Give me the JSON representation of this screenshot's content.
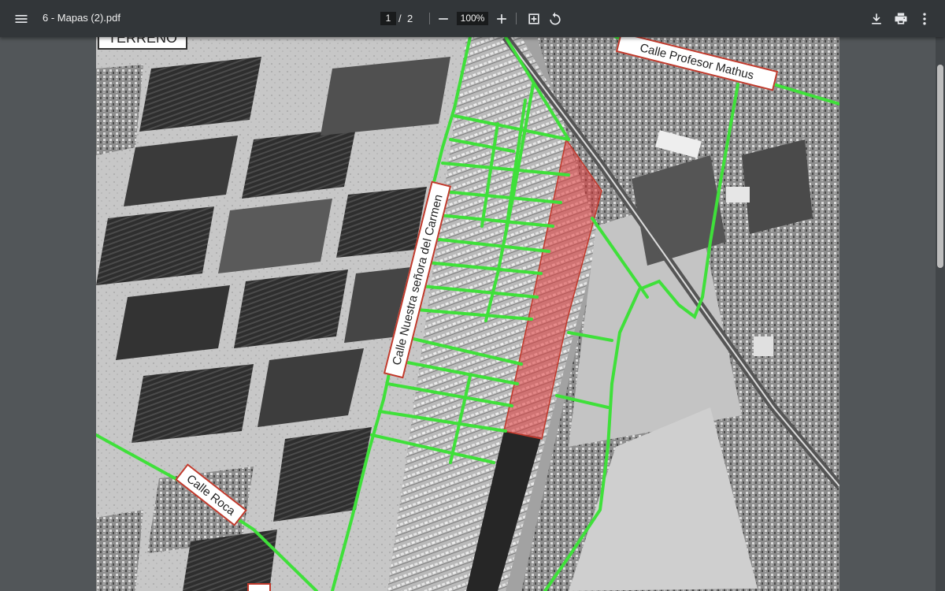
{
  "toolbar": {
    "menu_icon": "menu-icon",
    "title": "6 - Mapas (2).pdf",
    "current_page": "1",
    "page_separator": "/",
    "total_pages": "2",
    "zoom_out_icon": "minus-icon",
    "zoom_level": "100%",
    "zoom_in_icon": "plus-icon",
    "fit_icon": "fit-page-icon",
    "rotate_icon": "rotate-icon",
    "download_icon": "download-icon",
    "print_icon": "print-icon",
    "more_icon": "more-vert-icon"
  },
  "map": {
    "terreno_label": "TERRENO",
    "street_labels": {
      "profesor_mathus": "Calle Profesor Mathus",
      "nuestra_senora": "Calle Nuestra señora del Carmen",
      "roca": "Calle Roca"
    },
    "road_color": "#3fe03a",
    "parcel_color": "#e23a3a"
  }
}
